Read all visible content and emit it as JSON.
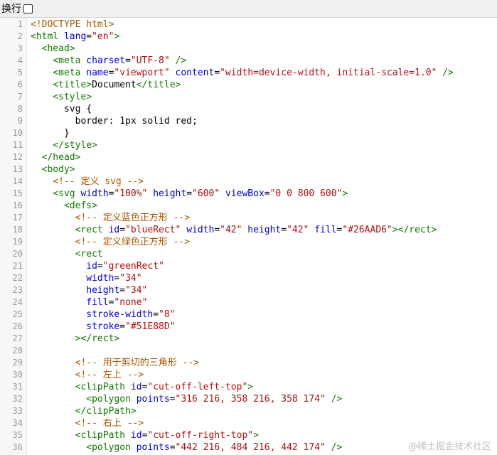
{
  "toolbar": {
    "wrap_label": "换行"
  },
  "watermark": "@稀土掘金技术社区",
  "lines": [
    {
      "n": "1",
      "tokens": [
        [
          "cm",
          "<!DOCTYPE html>"
        ]
      ]
    },
    {
      "n": "2",
      "tokens": [
        [
          "tg",
          "<html "
        ],
        [
          "at",
          "lang"
        ],
        [
          "tx",
          "="
        ],
        [
          "st",
          "\"en\""
        ],
        [
          "tg",
          ">"
        ]
      ]
    },
    {
      "n": "3",
      "tokens": [
        [
          "tx",
          "  "
        ],
        [
          "tg",
          "<head>"
        ]
      ]
    },
    {
      "n": "4",
      "tokens": [
        [
          "tx",
          "    "
        ],
        [
          "tg",
          "<meta "
        ],
        [
          "at",
          "charset"
        ],
        [
          "tx",
          "="
        ],
        [
          "st",
          "\"UTF-8\""
        ],
        [
          "tg",
          " />"
        ]
      ]
    },
    {
      "n": "5",
      "tokens": [
        [
          "tx",
          "    "
        ],
        [
          "tg",
          "<meta "
        ],
        [
          "at",
          "name"
        ],
        [
          "tx",
          "="
        ],
        [
          "st",
          "\"viewport\""
        ],
        [
          "tx",
          " "
        ],
        [
          "at",
          "content"
        ],
        [
          "tx",
          "="
        ],
        [
          "st",
          "\"width=device-width, initial-scale=1.0\""
        ],
        [
          "tg",
          " />"
        ]
      ]
    },
    {
      "n": "6",
      "tokens": [
        [
          "tx",
          "    "
        ],
        [
          "tg",
          "<title>"
        ],
        [
          "tx",
          "Document"
        ],
        [
          "tg",
          "</title>"
        ]
      ]
    },
    {
      "n": "7",
      "tokens": [
        [
          "tx",
          "    "
        ],
        [
          "tg",
          "<style>"
        ]
      ]
    },
    {
      "n": "8",
      "tokens": [
        [
          "tx",
          "      svg {"
        ]
      ]
    },
    {
      "n": "9",
      "tokens": [
        [
          "tx",
          "        border: 1px solid red;"
        ]
      ]
    },
    {
      "n": "10",
      "tokens": [
        [
          "tx",
          "      }"
        ]
      ]
    },
    {
      "n": "11",
      "tokens": [
        [
          "tx",
          "    "
        ],
        [
          "tg",
          "</style>"
        ]
      ]
    },
    {
      "n": "12",
      "tokens": [
        [
          "tx",
          "  "
        ],
        [
          "tg",
          "</head>"
        ]
      ]
    },
    {
      "n": "13",
      "tokens": [
        [
          "tx",
          "  "
        ],
        [
          "tg",
          "<body>"
        ]
      ]
    },
    {
      "n": "14",
      "tokens": [
        [
          "tx",
          "    "
        ],
        [
          "cm",
          "<!-- 定义 svg -->"
        ]
      ]
    },
    {
      "n": "15",
      "tokens": [
        [
          "tx",
          "    "
        ],
        [
          "tg",
          "<svg "
        ],
        [
          "at",
          "width"
        ],
        [
          "tx",
          "="
        ],
        [
          "st",
          "\"100%\""
        ],
        [
          "tx",
          " "
        ],
        [
          "at",
          "height"
        ],
        [
          "tx",
          "="
        ],
        [
          "st",
          "\"600\""
        ],
        [
          "tx",
          " "
        ],
        [
          "at",
          "viewBox"
        ],
        [
          "tx",
          "="
        ],
        [
          "st",
          "\"0 0 800 600\""
        ],
        [
          "tg",
          ">"
        ]
      ]
    },
    {
      "n": "16",
      "tokens": [
        [
          "tx",
          "      "
        ],
        [
          "tg",
          "<defs>"
        ]
      ]
    },
    {
      "n": "17",
      "tokens": [
        [
          "tx",
          "        "
        ],
        [
          "cm",
          "<!-- 定义蓝色正方形 -->"
        ]
      ]
    },
    {
      "n": "18",
      "tokens": [
        [
          "tx",
          "        "
        ],
        [
          "tg",
          "<rect "
        ],
        [
          "at",
          "id"
        ],
        [
          "tx",
          "="
        ],
        [
          "st",
          "\"blueRect\""
        ],
        [
          "tx",
          " "
        ],
        [
          "at",
          "width"
        ],
        [
          "tx",
          "="
        ],
        [
          "st",
          "\"42\""
        ],
        [
          "tx",
          " "
        ],
        [
          "at",
          "height"
        ],
        [
          "tx",
          "="
        ],
        [
          "st",
          "\"42\""
        ],
        [
          "tx",
          " "
        ],
        [
          "at",
          "fill"
        ],
        [
          "tx",
          "="
        ],
        [
          "st",
          "\"#26AAD6\""
        ],
        [
          "tg",
          "></rect>"
        ]
      ]
    },
    {
      "n": "19",
      "tokens": [
        [
          "tx",
          "        "
        ],
        [
          "cm",
          "<!-- 定义绿色正方形 -->"
        ]
      ]
    },
    {
      "n": "20",
      "tokens": [
        [
          "tx",
          "        "
        ],
        [
          "tg",
          "<rect"
        ]
      ]
    },
    {
      "n": "21",
      "tokens": [
        [
          "tx",
          "          "
        ],
        [
          "at",
          "id"
        ],
        [
          "tx",
          "="
        ],
        [
          "st",
          "\"greenRect\""
        ]
      ]
    },
    {
      "n": "22",
      "tokens": [
        [
          "tx",
          "          "
        ],
        [
          "at",
          "width"
        ],
        [
          "tx",
          "="
        ],
        [
          "st",
          "\"34\""
        ]
      ]
    },
    {
      "n": "23",
      "tokens": [
        [
          "tx",
          "          "
        ],
        [
          "at",
          "height"
        ],
        [
          "tx",
          "="
        ],
        [
          "st",
          "\"34\""
        ]
      ]
    },
    {
      "n": "24",
      "tokens": [
        [
          "tx",
          "          "
        ],
        [
          "at",
          "fill"
        ],
        [
          "tx",
          "="
        ],
        [
          "st",
          "\"none\""
        ]
      ]
    },
    {
      "n": "25",
      "tokens": [
        [
          "tx",
          "          "
        ],
        [
          "at",
          "stroke-width"
        ],
        [
          "tx",
          "="
        ],
        [
          "st",
          "\"8\""
        ]
      ]
    },
    {
      "n": "26",
      "tokens": [
        [
          "tx",
          "          "
        ],
        [
          "at",
          "stroke"
        ],
        [
          "tx",
          "="
        ],
        [
          "st",
          "\"#51E88D\""
        ]
      ]
    },
    {
      "n": "27",
      "tokens": [
        [
          "tx",
          "        "
        ],
        [
          "tg",
          "></rect>"
        ]
      ]
    },
    {
      "n": "28",
      "tokens": []
    },
    {
      "n": "29",
      "tokens": [
        [
          "tx",
          "        "
        ],
        [
          "cm",
          "<!-- 用于剪切的三角形 -->"
        ]
      ]
    },
    {
      "n": "30",
      "tokens": [
        [
          "tx",
          "        "
        ],
        [
          "cm",
          "<!-- 左上 -->"
        ]
      ]
    },
    {
      "n": "31",
      "tokens": [
        [
          "tx",
          "        "
        ],
        [
          "tg",
          "<clipPath "
        ],
        [
          "at",
          "id"
        ],
        [
          "tx",
          "="
        ],
        [
          "st",
          "\"cut-off-left-top\""
        ],
        [
          "tg",
          ">"
        ]
      ]
    },
    {
      "n": "32",
      "tokens": [
        [
          "tx",
          "          "
        ],
        [
          "tg",
          "<polygon "
        ],
        [
          "at",
          "points"
        ],
        [
          "tx",
          "="
        ],
        [
          "st",
          "\"316 216, 358 216, 358 174\""
        ],
        [
          "tg",
          " />"
        ]
      ]
    },
    {
      "n": "33",
      "tokens": [
        [
          "tx",
          "        "
        ],
        [
          "tg",
          "</clipPath>"
        ]
      ]
    },
    {
      "n": "34",
      "tokens": [
        [
          "tx",
          "        "
        ],
        [
          "cm",
          "<!-- 右上 -->"
        ]
      ]
    },
    {
      "n": "35",
      "tokens": [
        [
          "tx",
          "        "
        ],
        [
          "tg",
          "<clipPath "
        ],
        [
          "at",
          "id"
        ],
        [
          "tx",
          "="
        ],
        [
          "st",
          "\"cut-off-right-top\""
        ],
        [
          "tg",
          ">"
        ]
      ]
    },
    {
      "n": "36",
      "tokens": [
        [
          "tx",
          "          "
        ],
        [
          "tg",
          "<polygon "
        ],
        [
          "at",
          "points"
        ],
        [
          "tx",
          "="
        ],
        [
          "st",
          "\"442 216, 484 216, 442 174\""
        ],
        [
          "tg",
          " />"
        ]
      ]
    }
  ]
}
